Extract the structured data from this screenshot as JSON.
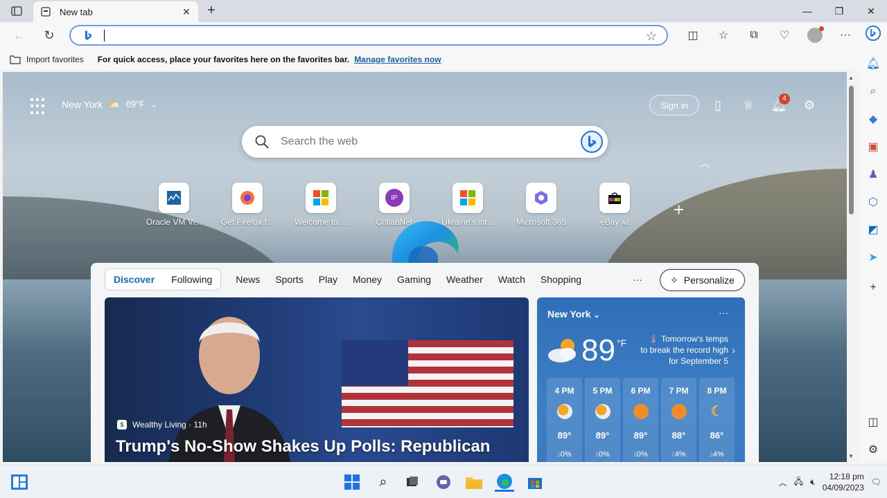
{
  "browser": {
    "tab_title": "New tab",
    "address_value": "",
    "favorites_bar": {
      "import_label": "Import favorites",
      "message": "For quick access, place your favorites here on the favorites bar.",
      "link": "Manage favorites now"
    }
  },
  "ntp": {
    "location": "New York",
    "temperature": "89",
    "temp_unit": "°F",
    "sign_in_label": "Sign in",
    "notification_count": "4",
    "search_placeholder": "Search the web",
    "quick_links": [
      {
        "label": "Oracle VM Vi...",
        "icon": "virtualbox-icon"
      },
      {
        "label": "Get Firefox f...",
        "icon": "firefox-icon"
      },
      {
        "label": "Welcome to ...",
        "icon": "microsoft-icon"
      },
      {
        "label": "CollabNet",
        "icon": "ip-icon",
        "initials": "IP"
      },
      {
        "label": "Ukraine's int...",
        "icon": "microsoft-icon"
      },
      {
        "label": "Microsoft 365",
        "icon": "m365-icon"
      },
      {
        "label": "eBay",
        "icon": "ebay-icon",
        "badge": "Ad"
      }
    ]
  },
  "feed": {
    "pill_tabs": [
      "Discover",
      "Following"
    ],
    "tabs": [
      "News",
      "Sports",
      "Play",
      "Money",
      "Gaming",
      "Weather",
      "Watch",
      "Shopping"
    ],
    "more_label": "···",
    "personalize_label": "Personalize",
    "hero": {
      "source": "Wealthy Living · 11h",
      "headline": "Trump's No-Show Shakes Up Polls: Republican"
    },
    "weather": {
      "city": "New York",
      "temperature": "89",
      "unit": "°F",
      "alert": "Tomorrow's temps to break the record high for September 5",
      "hourly": [
        {
          "time": "4 PM",
          "temp": "89°",
          "precip": "0%",
          "icon": "partly-cloudy-icon"
        },
        {
          "time": "5 PM",
          "temp": "89°",
          "precip": "0%",
          "icon": "partly-cloudy-icon"
        },
        {
          "time": "6 PM",
          "temp": "89°",
          "precip": "0%",
          "icon": "sun-icon"
        },
        {
          "time": "7 PM",
          "temp": "88°",
          "precip": "4%",
          "icon": "sun-icon"
        },
        {
          "time": "8 PM",
          "temp": "86°",
          "precip": "4%",
          "icon": "moon-icon"
        }
      ]
    }
  },
  "taskbar": {
    "time": "12:18 pm",
    "date": "04/09/2023"
  },
  "colors": {
    "accent": "#0f6cbd",
    "omnibox_border": "#6b9ae6",
    "weather_card": "#3c7ec5",
    "badge": "#d1462f"
  }
}
